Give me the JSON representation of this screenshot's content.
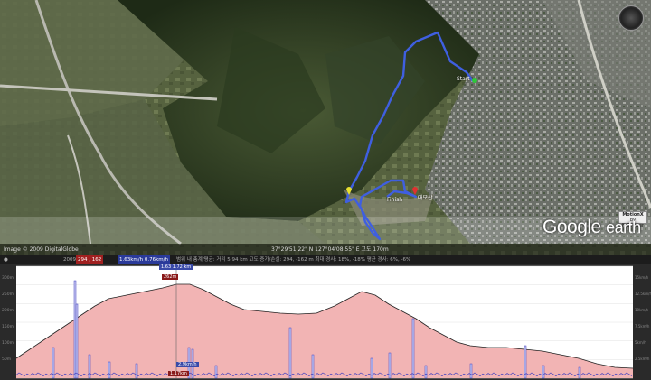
{
  "map": {
    "start_label": "Start",
    "finish_label": "Finish",
    "place_label": "대모산",
    "attribution_left": "Image © 2009 DigitalGlobe",
    "attribution_right": "37°29'51.22\" N 127°04'08.55\" E  고도 170m",
    "logo_google": "Google",
    "logo_earth": "earth",
    "motionx_title": "MotionX",
    "motionx_sub": "by Fullpower",
    "track_color": "#3f5fe0"
  },
  "stats": {
    "status_left": "2009",
    "range_label": "범위 내 총계/평균: 거리  5.94 km  고도 증가/손실: 294, -162 m  최대 경사: 18%, -18%  평균 경사: 6%, -6%",
    "elevation_badge": "294 , 162",
    "speed_badge": "1.63km/h  0.76km/h"
  },
  "profile": {
    "cursor_top_label": "1.63 1.72 km",
    "cursor_value_label": "262m",
    "cursor_bottom_label": "1.17km",
    "speed_marker_label": "2.9km/h",
    "elevation_color": "#f2b4b4",
    "speed_color": "#4040c0",
    "y_left_ticks": [
      "300m",
      "250m",
      "200m",
      "150m",
      "100m",
      "50m"
    ],
    "y_right_ticks": [
      "15km/h",
      "12.5km/h",
      "10km/h",
      "7.5km/h",
      "5km/h",
      "2.5km/h"
    ]
  }
}
